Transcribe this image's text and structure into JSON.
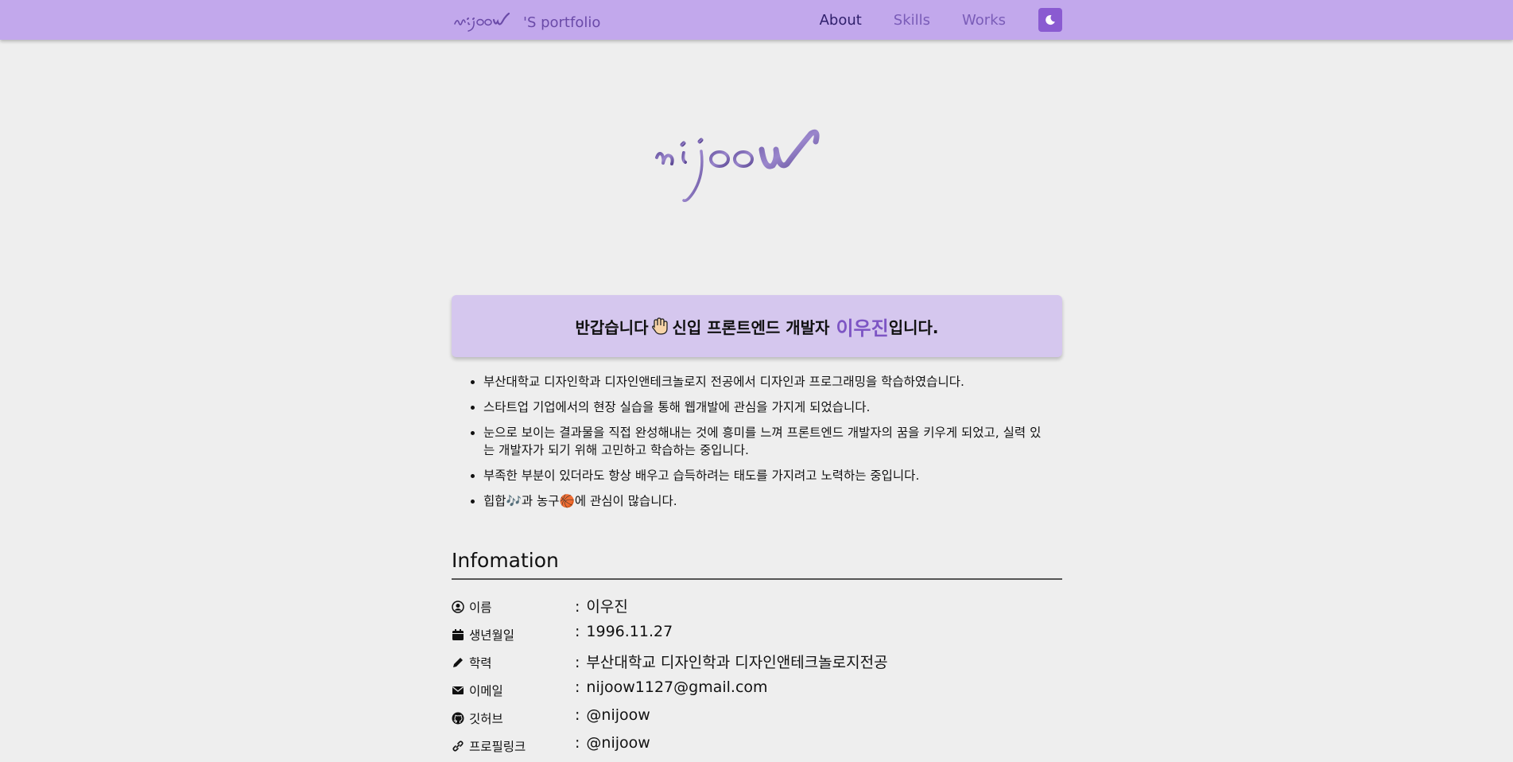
{
  "header": {
    "brand_text": "'S portfolio",
    "nav": [
      "About",
      "Skills",
      "Works"
    ],
    "active_nav": "About",
    "theme_icon": "moon-icon"
  },
  "intro": {
    "greeting_pre": "반갑습니다",
    "greeting_mid": "신입 프론트엔드 개발자",
    "name": "이우진",
    "greeting_post": "입니다.",
    "bullets": [
      "부산대학교 디자인학과 디자인앤테크놀로지 전공에서 디자인과 프로그래밍을 학습하였습니다.",
      "스타트업 기업에서의 현장 실습을 통해 웹개발에 관심을 가지게 되었습니다.",
      "눈으로 보이는 결과물을 직접 완성해내는 것에 흥미를 느껴 프론트엔드 개발자의 꿈을 키우게 되었고, 실력 있는 개발자가 되기 위해 고민하고 학습하는 중입니다.",
      "부족한 부분이 있더라도 항상 배우고 습득하려는 태도를 가지려고 노력하는 중입니다.",
      "힙합🎶과 농구🏀에 관심이 많습니다."
    ]
  },
  "info": {
    "title": "Infomation",
    "rows": [
      {
        "icon": "user-circle-icon",
        "label": "이름",
        "value": "이우진"
      },
      {
        "icon": "calendar-icon",
        "label": "생년월일",
        "value": "1996.11.27"
      },
      {
        "icon": "pencil-icon",
        "label": "학력",
        "value": "부산대학교 디자인학과 디자인앤테크놀로지전공"
      },
      {
        "icon": "envelope-icon",
        "label": "이메일",
        "value": "nijoow1127@gmail.com"
      },
      {
        "icon": "github-icon",
        "label": "깃허브",
        "value": "@nijoow"
      },
      {
        "icon": "link-icon",
        "label": "프로필링크",
        "value": "@nijoow"
      }
    ]
  },
  "colors": {
    "header_bg": "#c2a8ec",
    "intro_bg": "#d5c7ee",
    "accent": "#7d55c4",
    "theme_button": "#8a5bd1",
    "page_bg": "#eeeeee"
  }
}
